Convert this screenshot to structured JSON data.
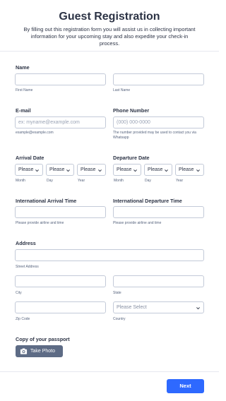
{
  "header": {
    "title": "Guest Registration",
    "subtitle": "By filling out this registration form you will assist us in collecting important information for your upcoming stay and also expedite your check-in process."
  },
  "name": {
    "label": "Name",
    "first_sub": "First Name",
    "last_sub": "Last Name"
  },
  "email": {
    "label": "E-mail",
    "placeholder": "ex: myname@example.com",
    "sub": "example@example.com"
  },
  "phone": {
    "label": "Phone Number",
    "placeholder": "(000) 000-0000",
    "sub": "The number provided may be used to contact you via Whatsapp"
  },
  "arrival_date": {
    "label": "Arrival Date",
    "month": "Please",
    "day": "Please",
    "year": "Please",
    "month_sub": "Month",
    "day_sub": "Day",
    "year_sub": "Year"
  },
  "departure_date": {
    "label": "Departure Date",
    "month": "Please",
    "day": "Please",
    "year": "Please",
    "month_sub": "Month",
    "day_sub": "Day",
    "year_sub": "Year"
  },
  "arrival_time": {
    "label": "International Arrival Time",
    "sub": "Please provide airline and time"
  },
  "departure_time": {
    "label": "International Departure Time",
    "sub": "Please provide airline and time"
  },
  "address": {
    "label": "Address",
    "street_sub": "Street Address",
    "city_sub": "City",
    "state_sub": "State",
    "zip_sub": "Zip Code",
    "country_sub": "Country",
    "country_placeholder": "Please Select"
  },
  "passport": {
    "label": "Copy of your passport",
    "button": "Take Photo"
  },
  "footer": {
    "next": "Next"
  },
  "icons": {
    "chevron": "chevron-down-icon",
    "camera": "camera-icon"
  },
  "colors": {
    "primary": "#2e69ff",
    "secondary_button": "#5d6b85",
    "text": "#2c3345",
    "border": "#c3cad8"
  }
}
